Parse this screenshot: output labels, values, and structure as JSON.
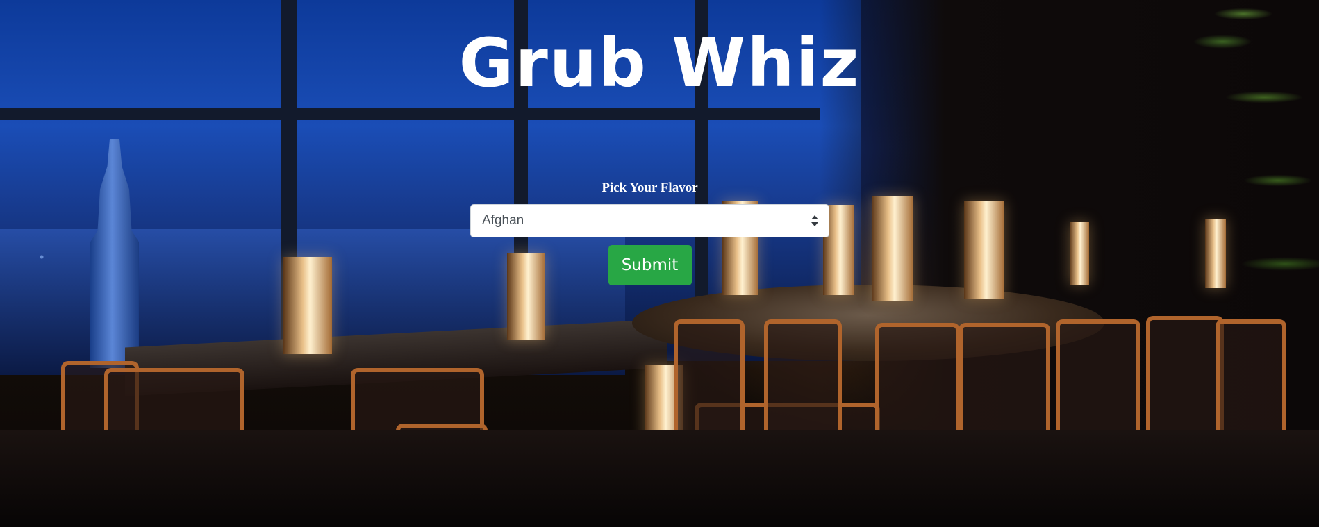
{
  "header": {
    "title": "Grub Whiz"
  },
  "form": {
    "label": "Pick Your Flavor",
    "selected_cuisine": "Afghan",
    "submit_label": "Submit"
  },
  "colors": {
    "submit_button": "#28a745",
    "title_text": "#ffffff"
  },
  "icons": {
    "select_arrows": "updown-caret-icon"
  }
}
